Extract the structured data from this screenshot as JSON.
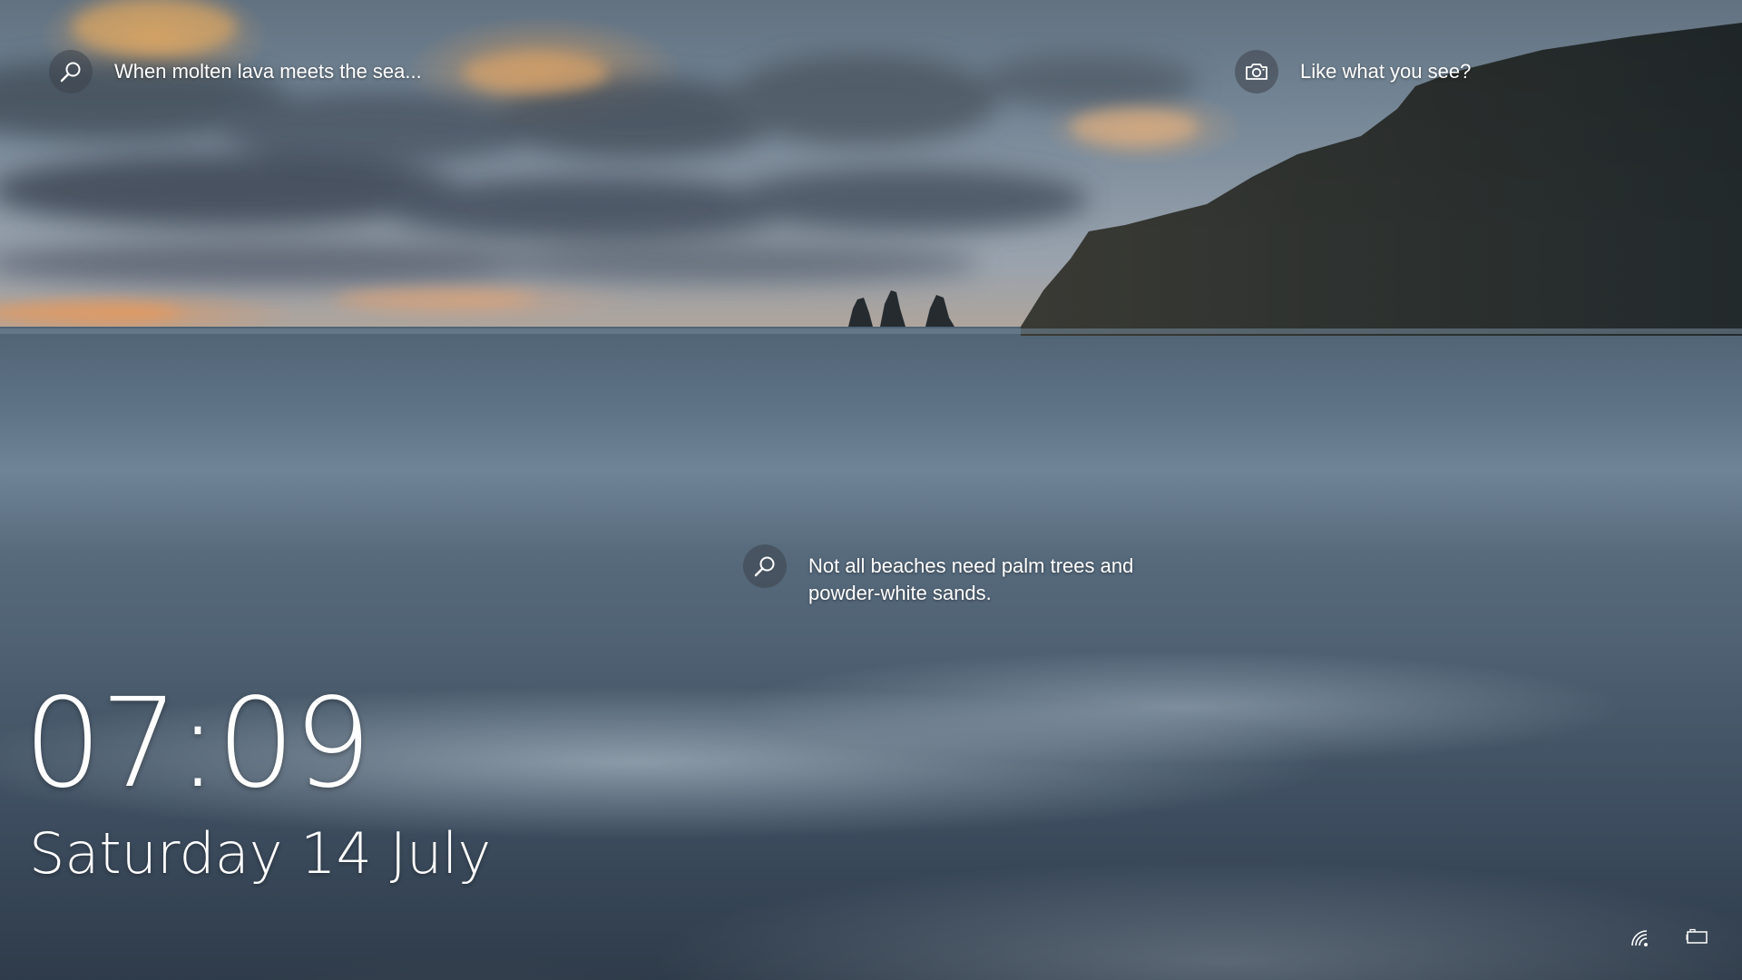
{
  "lockscreen": {
    "clock": {
      "time": "07:09"
    },
    "date": {
      "text": "Saturday 14 July"
    },
    "spotlight": {
      "top_left": {
        "icon": "search-icon",
        "text": "When molten lava meets the sea..."
      },
      "top_right": {
        "icon": "camera-icon",
        "text": "Like what you see?"
      },
      "center": {
        "icon": "search-icon",
        "text": "Not all beaches need palm trees and\npowder-white sands."
      }
    },
    "status": {
      "network_icon": "wifi-icon",
      "battery_icon": "battery-icon"
    }
  }
}
